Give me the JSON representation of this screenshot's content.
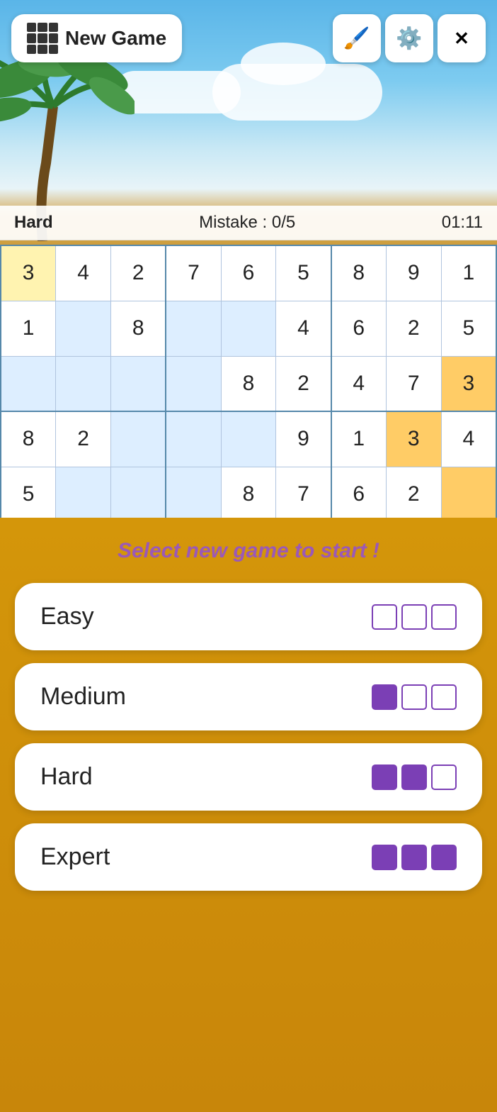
{
  "header": {
    "new_game_label": "New Game",
    "paint_icon": "🖌",
    "settings_icon": "⚙",
    "close_icon": "✕"
  },
  "status": {
    "difficulty": "Hard",
    "mistakes_label": "Mistake : 0/5",
    "timer": "01:11"
  },
  "grid": {
    "rows": [
      [
        "3",
        "4",
        "2",
        "7",
        "6",
        "5",
        "8",
        "9",
        "1"
      ],
      [
        "1",
        "",
        "8",
        "",
        "",
        "4",
        "6",
        "2",
        "5"
      ],
      [
        "",
        "",
        "",
        "",
        "8",
        "2",
        "4",
        "7",
        "3"
      ],
      [
        "8",
        "2",
        "",
        "",
        "",
        "9",
        "1",
        "3",
        "4"
      ],
      [
        "5",
        "",
        "",
        "",
        "8",
        "7",
        "6",
        "2",
        ""
      ]
    ],
    "highlights": {
      "yellow": [
        [
          0,
          0
        ]
      ],
      "orange": [
        [
          2,
          8
        ],
        [
          3,
          7
        ],
        [
          4,
          8
        ]
      ],
      "blue": [
        [
          1,
          1
        ],
        [
          1,
          3
        ],
        [
          1,
          4
        ],
        [
          2,
          0
        ],
        [
          2,
          1
        ],
        [
          2,
          2
        ],
        [
          2,
          3
        ],
        [
          3,
          2
        ],
        [
          3,
          3
        ],
        [
          3,
          4
        ],
        [
          4,
          1
        ],
        [
          4,
          2
        ],
        [
          4,
          3
        ]
      ]
    }
  },
  "overlay": {
    "select_text": "Select new game to start !",
    "difficulties": [
      {
        "label": "Easy",
        "filled": 0,
        "total": 3
      },
      {
        "label": "Medium",
        "filled": 1,
        "total": 3
      },
      {
        "label": "Hard",
        "filled": 2,
        "total": 3
      },
      {
        "label": "Expert",
        "filled": 3,
        "total": 3
      }
    ]
  }
}
